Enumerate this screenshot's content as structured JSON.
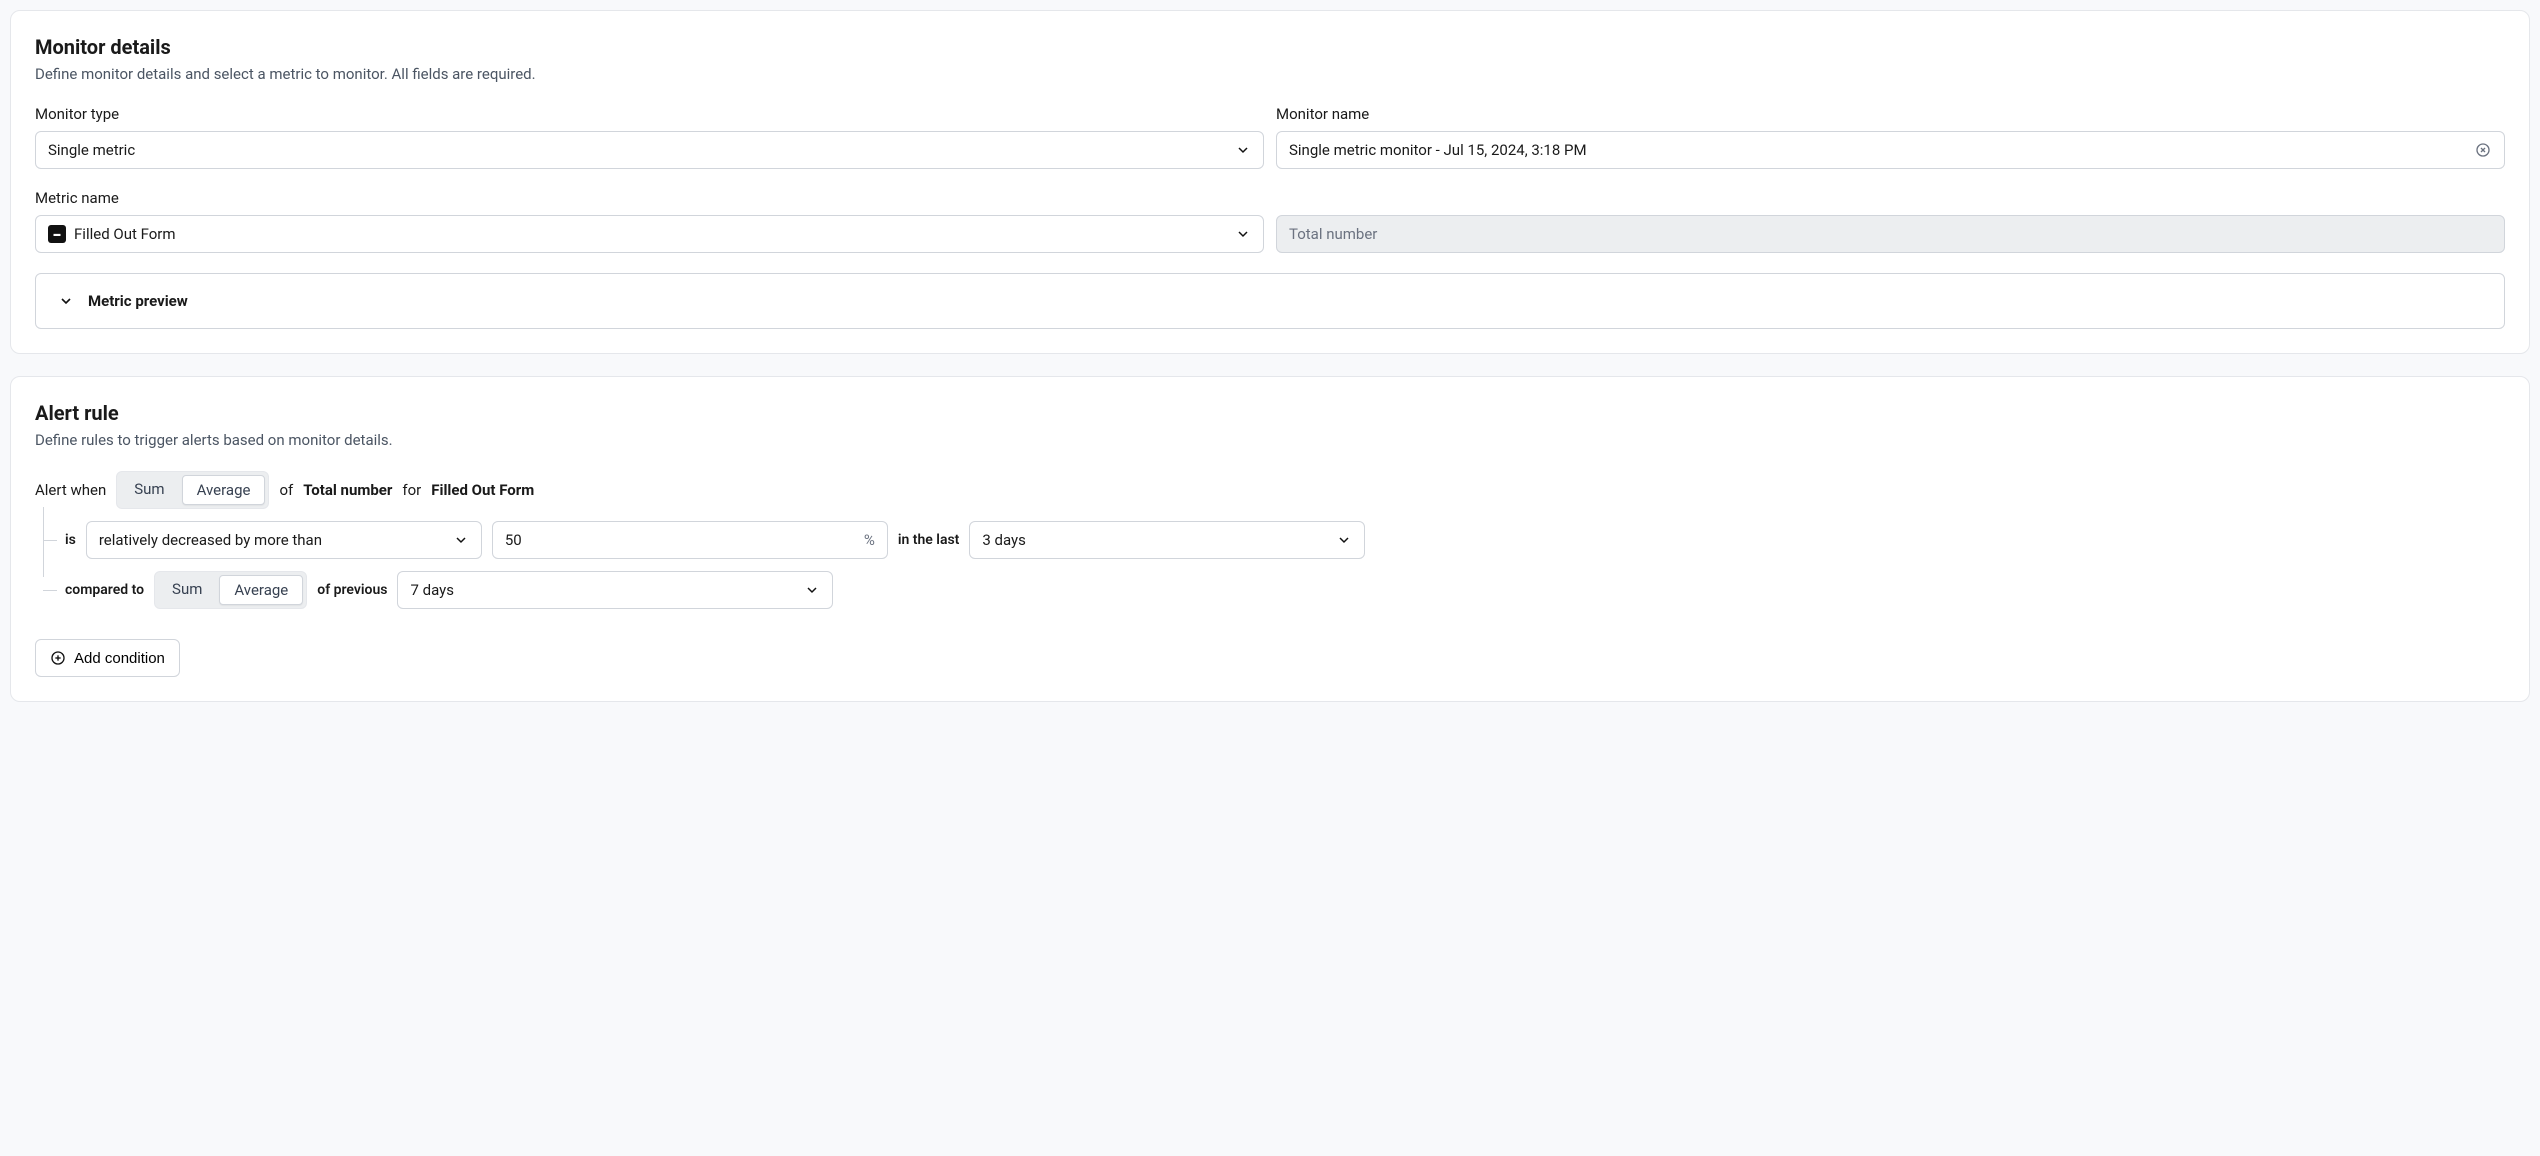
{
  "monitor_details": {
    "title": "Monitor details",
    "subtitle": "Define monitor details and select a metric to monitor. All fields are required.",
    "monitor_type_label": "Monitor type",
    "monitor_type_value": "Single metric",
    "monitor_name_label": "Monitor name",
    "monitor_name_value": "Single metric monitor - Jul 15, 2024, 3:18 PM",
    "metric_name_label": "Metric name",
    "metric_name_value": "Filled Out Form",
    "aggregation_value": "Total number",
    "preview_label": "Metric preview"
  },
  "alert_rule": {
    "title": "Alert rule",
    "subtitle": "Define rules to trigger alerts based on monitor details.",
    "alert_when": "Alert when",
    "pill_sum": "Sum",
    "pill_average": "Average",
    "of": "of",
    "total_number": "Total number",
    "for": "for",
    "metric": "Filled Out Form",
    "is": "is",
    "comparison_value": "relatively decreased by more than",
    "threshold_value": "50",
    "threshold_unit": "%",
    "in_the_last": "in the last",
    "window_value": "3 days",
    "compared_to": "compared to",
    "of_previous": "of previous",
    "previous_window_value": "7 days",
    "add_condition": "Add condition"
  }
}
